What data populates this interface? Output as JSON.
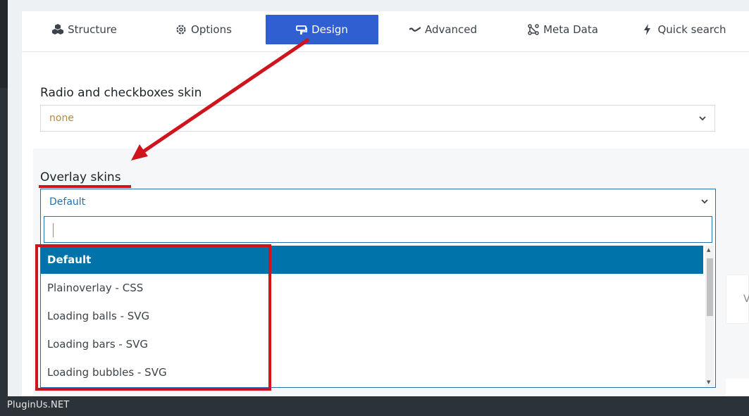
{
  "tabs": [
    {
      "label": "Structure",
      "icon": "cubes-icon",
      "active": false
    },
    {
      "label": "Options",
      "icon": "gear-icon",
      "active": false
    },
    {
      "label": "Design",
      "icon": "paint-icon",
      "active": true
    },
    {
      "label": "Advanced",
      "icon": "wave-icon",
      "active": false
    },
    {
      "label": "Meta Data",
      "icon": "nodes-icon",
      "active": false
    },
    {
      "label": "Quick search",
      "icon": "bolt-icon",
      "active": false
    }
  ],
  "radio_skin": {
    "label": "Radio and checkboxes skin",
    "value": "none"
  },
  "overlay_skins": {
    "label": "Overlay skins",
    "value": "Default",
    "search_value": "",
    "options": [
      "Default",
      "Plainoverlay - CSS",
      "Loading balls - SVG",
      "Loading bars - SVG",
      "Loading bubbles - SVG"
    ],
    "highlighted_index": 0
  },
  "right_card_text": "V",
  "footer_text": "PluginUs.NET",
  "colors": {
    "accent": "#2f5fd0",
    "annotation": "#d0141d",
    "highlight": "#0073aa",
    "value_gold": "#b08a3e"
  }
}
